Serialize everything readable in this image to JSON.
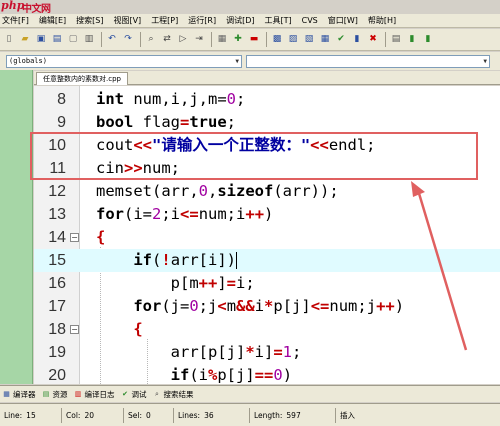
{
  "watermark": {
    "php": "php",
    "cn": "中文网"
  },
  "menu": [
    "文件[F]",
    "编辑[E]",
    "搜索[S]",
    "视图[V]",
    "工程[P]",
    "运行[R]",
    "调试[D]",
    "工具[T]",
    "CVS",
    "窗口[W]",
    "帮助[H]"
  ],
  "scope": {
    "value": "(globals)"
  },
  "editor_tab": {
    "label": "任意整数内的素数对.cpp"
  },
  "code_lines": [
    {
      "num": "8"
    },
    {
      "num": "9"
    },
    {
      "num": "10"
    },
    {
      "num": "11"
    },
    {
      "num": "12"
    },
    {
      "num": "13"
    },
    {
      "num": "14"
    },
    {
      "num": "15"
    },
    {
      "num": "16"
    },
    {
      "num": "17"
    },
    {
      "num": "18"
    },
    {
      "num": "19"
    },
    {
      "num": "20"
    }
  ],
  "code": {
    "l8": {
      "kw": "int",
      "rest": " num,i,j,m=",
      "n": "0",
      "end": ";"
    },
    "l9": {
      "kw": "bool",
      "rest": " flag",
      "op": "=",
      "kw2": "true",
      "end": ";"
    },
    "l10": {
      "a": "cout",
      "op": "<<",
      "str": "\"请输入一个正整数：\"",
      "op2": "<<",
      "b": "endl;"
    },
    "l11": {
      "a": "cin",
      "op": ">>",
      "b": "num;"
    },
    "l12": {
      "a": "memset(arr,",
      "n": "0",
      "b": ",",
      "kw": "sizeof",
      "c": "(arr));"
    },
    "l13": {
      "kw": "for",
      "a": "(i=",
      "n": "2",
      "b": ";i",
      "op": "<=",
      "c": "num;i",
      "op2": "++",
      "d": ")"
    },
    "l14": {
      "a": "{"
    },
    "l15": {
      "kw": "if",
      "a": "(",
      "op": "!",
      "b": "arr[i])"
    },
    "l16": {
      "a": "p[m",
      "op": "++",
      "b": "]",
      "op2": "=",
      "c": "i;"
    },
    "l17": {
      "kw": "for",
      "a": "(j=",
      "n": "0",
      "b": ";j",
      "op": "<",
      "c": "m",
      "op2": "&&",
      "d": "i",
      "op3": "*",
      "e": "p[j]",
      "op4": "<=",
      "f": "num;j",
      "op5": "++",
      "g": ")"
    },
    "l18": {
      "a": "{"
    },
    "l19": {
      "a": "arr[p[j]",
      "op": "*",
      "b": "i]",
      "op2": "=",
      "n": "1",
      "c": ";"
    },
    "l20": {
      "kw": "if",
      "a": "(i",
      "op": "%",
      "b": "p[j]",
      "op2": "==",
      "n": "0",
      "c": ")"
    }
  },
  "bottom_tabs": [
    {
      "label": "编译器",
      "icon": "compiler-icon"
    },
    {
      "label": "资源",
      "icon": "resource-icon"
    },
    {
      "label": "编译日志",
      "icon": "compile-log-icon"
    },
    {
      "label": "调试",
      "icon": "debug-icon"
    },
    {
      "label": "搜索结果",
      "icon": "search-results-icon"
    }
  ],
  "status": {
    "line_label": "Line:",
    "line": "15",
    "col_label": "Col:",
    "col": "20",
    "sel_label": "Sel:",
    "sel": "0",
    "lines_label": "Lines:",
    "lines": "36",
    "length_label": "Length:",
    "length": "597",
    "mode": "插入"
  },
  "colors": {
    "accent": "#e06060",
    "current_line": "#e0fbff",
    "operator": "#c00000",
    "string": "#0000a0"
  }
}
